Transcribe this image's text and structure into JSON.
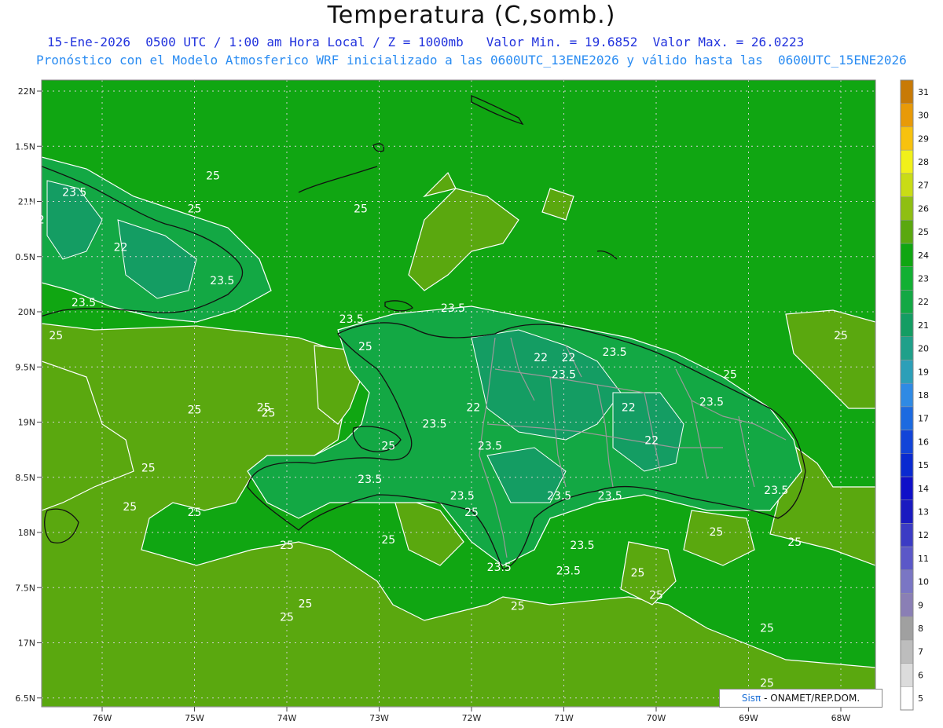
{
  "title": "Temperatura (C,somb.)",
  "subtitle_1": "15-Ene-2026  0500 UTC / 1:00 am Hora Local / Z = 1000mb   Valor Min. = 19.6852  Valor Max. = 26.0223",
  "subtitle_2": "Pronóstico con el Modelo Atmosferico WRF inicializado a las 0600UTC_13ENE2026 y válido hasta las  0600UTC_15ENE2026",
  "lat_labels": [
    "22N",
    "1.5N",
    "21N",
    "0.5N",
    "20N",
    "9.5N",
    "19N",
    "8.5N",
    "18N",
    "7.5N",
    "17N",
    "6.5N"
  ],
  "lon_labels": [
    "76W",
    "75W",
    "74W",
    "73W",
    "72W",
    "71W",
    "70W",
    "69W",
    "68W"
  ],
  "contour_labels": [
    {
      "text": "23.5",
      "lon": -76.3,
      "lat": 21.05
    },
    {
      "text": "22",
      "lon": -76.8,
      "lat": 20.92
    },
    {
      "text": "22",
      "lon": -76.7,
      "lat": 20.8
    },
    {
      "text": "22",
      "lon": -75.8,
      "lat": 20.55
    },
    {
      "text": "23.5",
      "lon": -74.7,
      "lat": 20.25
    },
    {
      "text": "23.5",
      "lon": -76.2,
      "lat": 20.05
    },
    {
      "text": "25",
      "lon": -76.5,
      "lat": 19.75
    },
    {
      "text": "25",
      "lon": -74.8,
      "lat": 21.2
    },
    {
      "text": "25",
      "lon": -75.0,
      "lat": 20.9
    },
    {
      "text": "25",
      "lon": -73.15,
      "lat": 19.65
    },
    {
      "text": "23.5",
      "lon": -73.3,
      "lat": 19.9
    },
    {
      "text": "23.5",
      "lon": -72.2,
      "lat": 20.0
    },
    {
      "text": "25",
      "lon": -73.2,
      "lat": 20.9
    },
    {
      "text": "25",
      "lon": -74.2,
      "lat": 19.05
    },
    {
      "text": "25",
      "lon": -72.9,
      "lat": 18.75
    },
    {
      "text": "23.5",
      "lon": -72.4,
      "lat": 18.95
    },
    {
      "text": "22",
      "lon": -71.98,
      "lat": 19.1
    },
    {
      "text": "23.5",
      "lon": -71.8,
      "lat": 18.75
    },
    {
      "text": "22",
      "lon": -71.25,
      "lat": 19.55
    },
    {
      "text": "23.5",
      "lon": -71.0,
      "lat": 19.4
    },
    {
      "text": "22",
      "lon": -70.95,
      "lat": 19.55
    },
    {
      "text": "23.5",
      "lon": -70.45,
      "lat": 19.6
    },
    {
      "text": "22",
      "lon": -70.3,
      "lat": 19.1
    },
    {
      "text": "22",
      "lon": -70.05,
      "lat": 18.8
    },
    {
      "text": "23.5",
      "lon": -69.4,
      "lat": 19.15
    },
    {
      "text": "25",
      "lon": -69.2,
      "lat": 19.4
    },
    {
      "text": "25",
      "lon": -68.0,
      "lat": 19.75
    },
    {
      "text": "23.5",
      "lon": -73.1,
      "lat": 18.45
    },
    {
      "text": "23.5",
      "lon": -72.1,
      "lat": 18.3
    },
    {
      "text": "25",
      "lon": -72.0,
      "lat": 18.15
    },
    {
      "text": "23.5",
      "lon": -71.05,
      "lat": 18.3
    },
    {
      "text": "23.5",
      "lon": -70.5,
      "lat": 18.3
    },
    {
      "text": "23.5",
      "lon": -68.7,
      "lat": 18.35
    },
    {
      "text": "25",
      "lon": -75.5,
      "lat": 18.55
    },
    {
      "text": "25",
      "lon": -75.7,
      "lat": 18.2
    },
    {
      "text": "25",
      "lon": -75.0,
      "lat": 18.15
    },
    {
      "text": "25",
      "lon": -74.0,
      "lat": 17.85
    },
    {
      "text": "25",
      "lon": -72.9,
      "lat": 17.9
    },
    {
      "text": "23.5",
      "lon": -70.8,
      "lat": 17.85
    },
    {
      "text": "23.5",
      "lon": -71.7,
      "lat": 17.65
    },
    {
      "text": "23.5",
      "lon": -70.95,
      "lat": 17.62
    },
    {
      "text": "25",
      "lon": -70.2,
      "lat": 17.6
    },
    {
      "text": "25",
      "lon": -70.0,
      "lat": 17.4
    },
    {
      "text": "25",
      "lon": -69.35,
      "lat": 17.97
    },
    {
      "text": "25",
      "lon": -68.5,
      "lat": 17.88
    },
    {
      "text": "25",
      "lon": -74.0,
      "lat": 17.2
    },
    {
      "text": "25",
      "lon": -73.8,
      "lat": 17.32
    },
    {
      "text": "25",
      "lon": -71.5,
      "lat": 17.3
    },
    {
      "text": "25",
      "lon": -68.8,
      "lat": 17.1
    },
    {
      "text": "25",
      "lon": -68.8,
      "lat": 16.6
    },
    {
      "text": "25",
      "lon": -75.0,
      "lat": 19.08
    },
    {
      "text": "25",
      "lon": -74.25,
      "lat": 19.1
    }
  ],
  "colorbar": {
    "levels": [
      "5",
      "6",
      "7",
      "8",
      "9",
      "10",
      "11",
      "12",
      "13",
      "14",
      "15",
      "16",
      "17",
      "18",
      "19",
      "20",
      "21",
      "22",
      "23",
      "24",
      "25",
      "26",
      "27",
      "28",
      "29",
      "30",
      "31"
    ],
    "colors": [
      "#ffffff",
      "#dcdcdc",
      "#bdbdbd",
      "#a0a0a0",
      "#8a7fb5",
      "#7a76c4",
      "#5b58c8",
      "#3b3bc4",
      "#1a1ac0",
      "#1010c8",
      "#0a2ad0",
      "#1244d8",
      "#1c6ae0",
      "#2f8ae4",
      "#2c9fb8",
      "#1fa08a",
      "#149d63",
      "#13a844",
      "#12b033",
      "#10a612",
      "#5aa80f",
      "#8fbf12",
      "#c9dc16",
      "#f1f01a",
      "#f7c20e",
      "#e89a08",
      "#c87a06"
    ]
  },
  "field_colors": {
    "lt22": "#149d63",
    "lt23": "#13a844",
    "lt24": "#12b033",
    "lt25": "#10a612",
    "ge25": "#5aa80f"
  },
  "credit": {
    "brand": "Sisπ",
    "text": "- ONAMET/REP.DOM."
  }
}
